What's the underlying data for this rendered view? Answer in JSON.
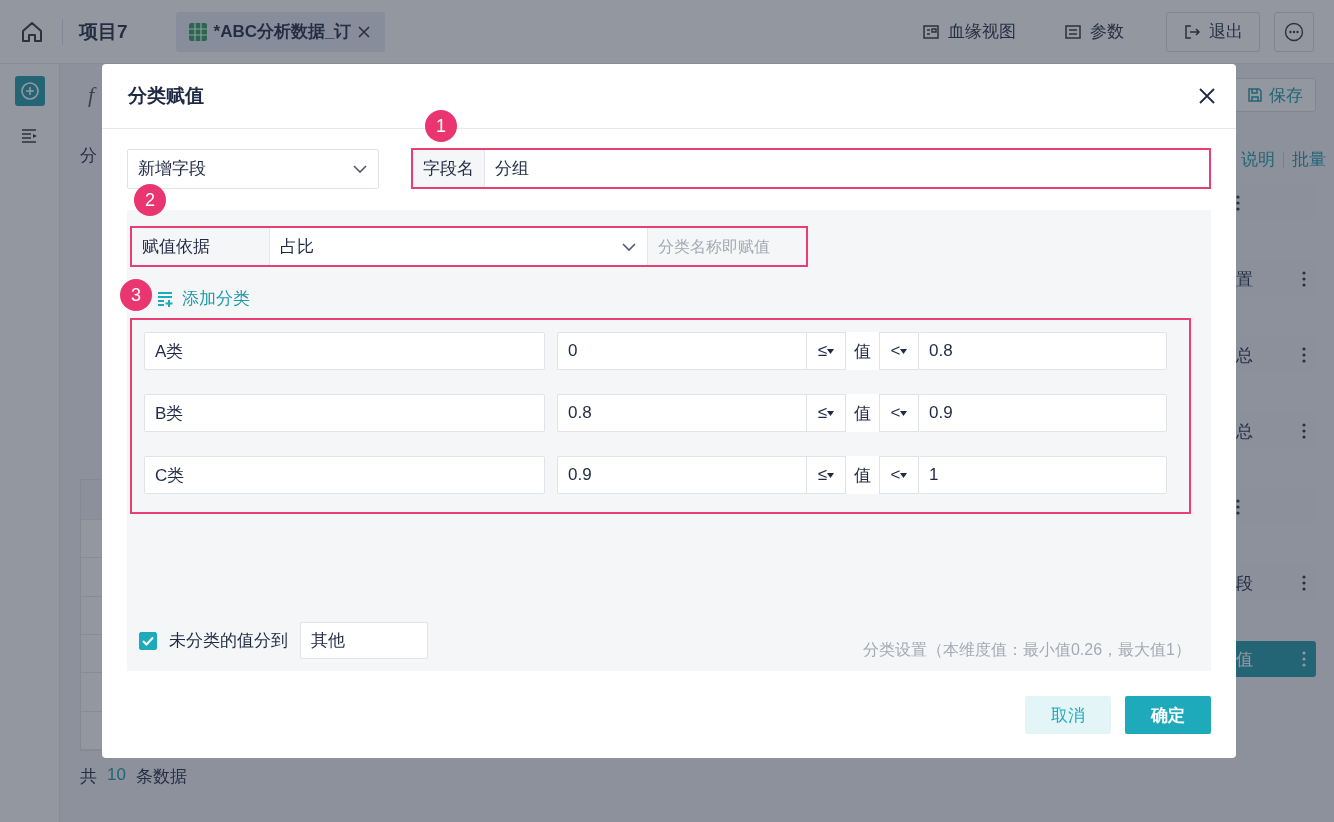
{
  "app_bar": {
    "project": "项目7",
    "tab": {
      "label": "*ABC分析数据_订"
    },
    "actions": [
      "血缘视图",
      "参数",
      "退出"
    ]
  },
  "editor": {
    "formula_prefix": "f",
    "left_label": "分",
    "save": "保存",
    "links": [
      "说明",
      "批量"
    ],
    "steps": [
      {
        "selected": false
      },
      {
        "label": "置",
        "selected": false
      },
      {
        "label": "总",
        "selected": false
      },
      {
        "label": "总",
        "selected": false
      },
      {
        "selected": false
      },
      {
        "label": "段",
        "selected": false
      },
      {
        "label": "值",
        "selected": true
      }
    ],
    "count": {
      "prefix": "共",
      "value": "10",
      "suffix": "条数据"
    }
  },
  "dialog": {
    "title": "分类赋值",
    "mode_select": "新增字段",
    "field_name": {
      "label": "字段名",
      "value": "分组"
    },
    "basis": {
      "label": "赋值依据",
      "value": "占比",
      "placeholder": "分类名称即赋值"
    },
    "add_label": "添加分类",
    "categories": [
      {
        "name": "A类",
        "low": "0",
        "low_op": "≤",
        "value_label": "值",
        "high_op": "<",
        "high": "0.8"
      },
      {
        "name": "B类",
        "low": "0.8",
        "low_op": "≤",
        "value_label": "值",
        "high_op": "<",
        "high": "0.9"
      },
      {
        "name": "C类",
        "low": "0.9",
        "low_op": "≤",
        "value_label": "值",
        "high_op": "<",
        "high": "1"
      }
    ],
    "other": {
      "checked": true,
      "label": "未分类的值分到",
      "value": "其他"
    },
    "info": "分类设置（本维度值：最小值0.26，最大值1）",
    "buttons": [
      {
        "label": "取消",
        "kind": "secondary"
      },
      {
        "label": "确定",
        "kind": "primary"
      }
    ]
  },
  "annotations": [
    "1",
    "2",
    "3"
  ]
}
